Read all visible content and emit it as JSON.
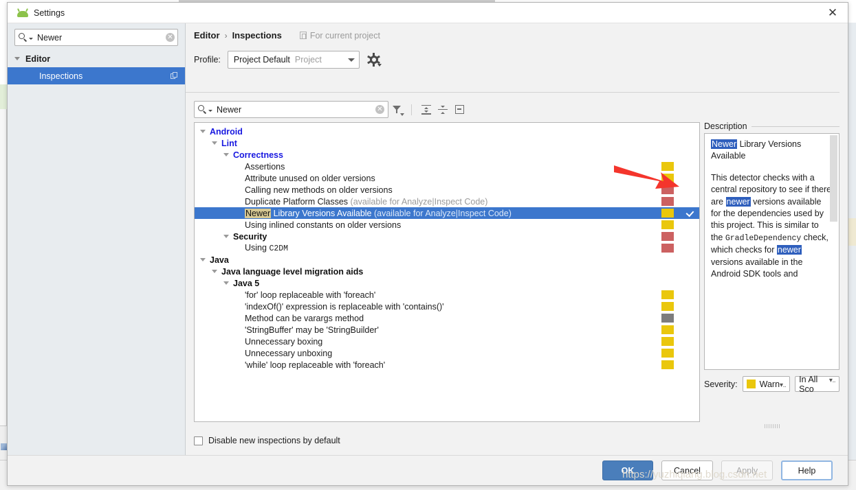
{
  "window": {
    "title": "Settings",
    "app_icon": "android-robot-icon",
    "close_label": "✕"
  },
  "nav": {
    "search": {
      "value": "Newer",
      "placeholder": "",
      "icon": "search-icon",
      "clear_icon": "clear-icon"
    },
    "groups": [
      {
        "label": "Editor",
        "expanded": true,
        "items": [
          {
            "label": "Inspections",
            "selected": true,
            "badge_icon": "copy-icon"
          }
        ]
      }
    ]
  },
  "header": {
    "breadcrumb_parent": "Editor",
    "breadcrumb_sep": "›",
    "breadcrumb_current": "Inspections",
    "for_current_project": "For current project",
    "profile_label": "Profile:",
    "profile_value": "Project Default",
    "profile_scope": "Project",
    "gear_icon": "gear-icon"
  },
  "toolbar": {
    "search": {
      "value": "Newer",
      "icon": "search-icon",
      "clear_icon": "clear-icon"
    },
    "filter_icon": "filter-funnel-icon",
    "expand_all_icon": "expand-all-icon",
    "collapse_all_icon": "collapse-all-icon",
    "toggle_icon": "show-only-enabled-icon"
  },
  "tree": {
    "rows": [
      {
        "label": "Android",
        "depth": 0,
        "style": "group-blue",
        "toggle": true,
        "severity": null,
        "checked": true
      },
      {
        "label": "Lint",
        "depth": 1,
        "style": "group-blue",
        "toggle": true,
        "severity": null,
        "checked": true
      },
      {
        "label": "Correctness",
        "depth": 2,
        "style": "group-blue",
        "toggle": true,
        "severity": null,
        "checked": true
      },
      {
        "label": "Assertions",
        "depth": 3,
        "style": "leaf",
        "toggle": false,
        "severity": "#eac70c",
        "checked": true
      },
      {
        "label": "Attribute unused on older versions",
        "depth": 3,
        "style": "leaf",
        "toggle": false,
        "severity": "#eac70c",
        "checked": true
      },
      {
        "label": "Calling new methods on older versions",
        "depth": 3,
        "style": "leaf",
        "toggle": false,
        "severity": "#cc6161",
        "checked": true
      },
      {
        "label": "Duplicate Platform Classes",
        "suffix": " (available for Analyze|Inspect Code)",
        "depth": 3,
        "style": "leaf",
        "toggle": false,
        "severity": "#cc6161",
        "checked": true
      },
      {
        "label": "Newer Library Versions Available",
        "highlight": "Newer",
        "suffix": " (available for Analyze|Inspect Code)",
        "depth": 3,
        "style": "leaf",
        "toggle": false,
        "severity": "#eac70c",
        "checked": true,
        "selected": true
      },
      {
        "label": "Using inlined constants on older versions",
        "depth": 3,
        "style": "leaf",
        "toggle": false,
        "severity": "#eac70c",
        "checked": true
      },
      {
        "label": "Security",
        "depth": 2,
        "style": "group-dark",
        "toggle": true,
        "severity": "#cc6161",
        "checked": true
      },
      {
        "label": "Using C2DM",
        "depth": 3,
        "style": "leaf-mono",
        "toggle": false,
        "severity": "#cc6161",
        "checked": true
      },
      {
        "label": "Java",
        "depth": 0,
        "style": "group-dark",
        "toggle": true,
        "severity": null,
        "checked": true
      },
      {
        "label": "Java language level migration aids",
        "depth": 1,
        "style": "group-dark",
        "toggle": true,
        "severity": null,
        "checked": true
      },
      {
        "label": "Java 5",
        "depth": 2,
        "style": "group-dark",
        "toggle": true,
        "severity": null,
        "checked": true
      },
      {
        "label": "'for' loop replaceable with 'foreach'",
        "depth": 3,
        "style": "leaf",
        "toggle": false,
        "severity": "#eac70c",
        "checked": true
      },
      {
        "label": "'indexOf()' expression is replaceable with 'contains()'",
        "depth": 3,
        "style": "leaf",
        "toggle": false,
        "severity": "#eac70c",
        "checked": true
      },
      {
        "label": "Method can be varargs method",
        "depth": 3,
        "style": "leaf",
        "toggle": false,
        "severity": "#7d7d7d",
        "checked": true
      },
      {
        "label": "'StringBuffer' may be 'StringBuilder'",
        "depth": 3,
        "style": "leaf",
        "toggle": false,
        "severity": "#eac70c",
        "checked": true
      },
      {
        "label": "Unnecessary boxing",
        "depth": 3,
        "style": "leaf",
        "toggle": false,
        "severity": "#eac70c",
        "checked": true
      },
      {
        "label": "Unnecessary unboxing",
        "depth": 3,
        "style": "leaf",
        "toggle": false,
        "severity": "#eac70c",
        "checked": true
      },
      {
        "label": "'while' loop replaceable with 'foreach'",
        "depth": 3,
        "style": "leaf",
        "toggle": false,
        "severity": "#eac70c",
        "checked": true
      }
    ]
  },
  "description": {
    "legend": "Description",
    "title_mark": "Newer",
    "title_rest": " Library Versions Available",
    "body_1": "This detector checks with a central repository to see if there are ",
    "body_mark_1": "newer",
    "body_2": " versions available for the dependencies used by this project. This is similar to the ",
    "body_code": "GradleDependency",
    "body_3": " check, which checks for ",
    "body_mark_2": "newer",
    "body_4": " versions available in the Android SDK tools and"
  },
  "severity_controls": {
    "label": "Severity:",
    "value": "Warn",
    "value_truncated": "Warn...",
    "swatch_color": "#eac70c",
    "scope": "In All Sco",
    "scope_truncated": "In All Sco..."
  },
  "options": {
    "disable_new_inspections": {
      "label": "Disable new inspections by default",
      "checked": false
    }
  },
  "footer": {
    "ok": "OK",
    "cancel": "Cancel",
    "apply": "Apply",
    "help": "Help"
  },
  "watermark": "https://yuzhiqiang.blog.csdn.net",
  "colors": {
    "accent_blue": "#3c77cd",
    "group_blue": "#1818e0",
    "severity_warning": "#eac70c",
    "severity_error": "#cc6161",
    "severity_gray": "#7d7d7d",
    "arrow_red": "#f4352c",
    "highlight_tan": "#d6c893"
  }
}
